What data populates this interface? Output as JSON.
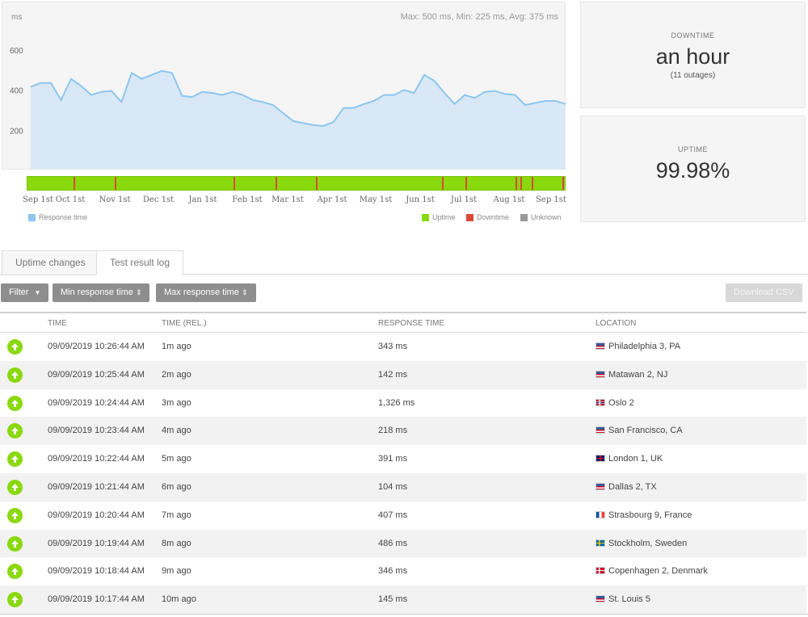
{
  "chart": {
    "y_unit": "ms",
    "stats": "Max: 500 ms, Min: 225 ms, Avg: 375 ms",
    "colors": {
      "fill": "#d9e8f6",
      "line": "#8cc6ee",
      "uptime": "#8ad80e",
      "downtime": "#d84a38",
      "unknown": "#999999"
    }
  },
  "chart_data": {
    "type": "area",
    "ylabel": "ms",
    "ylim": [
      0,
      700
    ],
    "yticks": [
      200,
      400,
      600
    ],
    "x_tick_labels": [
      "Sep 1st",
      "Oct 1st",
      "Nov 1st",
      "Dec 1st",
      "Jan 1st",
      "Feb 1st",
      "Mar 1st",
      "Apr 1st",
      "May 1st",
      "Jun 1st",
      "Jul 1st",
      "Aug 1st",
      "Sep 1st"
    ],
    "series": [
      {
        "name": "Response time",
        "values": [
          420,
          440,
          440,
          355,
          460,
          425,
          380,
          395,
          400,
          345,
          490,
          460,
          480,
          500,
          490,
          375,
          370,
          395,
          390,
          380,
          395,
          380,
          355,
          345,
          330,
          290,
          250,
          240,
          230,
          225,
          245,
          315,
          315,
          335,
          350,
          380,
          380,
          405,
          390,
          480,
          450,
          390,
          335,
          380,
          365,
          395,
          400,
          385,
          380,
          330,
          340,
          350,
          350,
          335
        ]
      }
    ],
    "status_bar": {
      "uptime_color": "#8ad80e",
      "downtime_color": "#d84a38",
      "outages_at": [
        0.085,
        0.163,
        0.384,
        0.462,
        0.537,
        0.771,
        0.815,
        0.909,
        0.917,
        0.938,
        0.996
      ]
    },
    "legend": [
      "Response time",
      "Uptime",
      "Downtime",
      "Unknown"
    ]
  },
  "legend": {
    "response_time": "Response time",
    "uptime": "Uptime",
    "downtime": "Downtime",
    "unknown": "Unknown"
  },
  "downtime": {
    "label": "DOWNTIME",
    "value": "an hour",
    "sub": "(11 outages)"
  },
  "uptime": {
    "label": "UPTIME",
    "value": "99.98%"
  },
  "tabs": [
    {
      "label": "Uptime changes"
    },
    {
      "label": "Test result log"
    }
  ],
  "toolbar": {
    "filter": "Filter",
    "min_response": "Min response time",
    "max_response": "Max response time",
    "download": "Download CSV"
  },
  "table": {
    "headers": [
      "TIME",
      "TIME (REL.)",
      "RESPONSE TIME",
      "LOCATION"
    ],
    "rows": [
      {
        "time": "09/09/2019 10:26:44 AM",
        "rel": "1m ago",
        "response": "343 ms",
        "location": "Philadelphia 3, PA",
        "flag": "us"
      },
      {
        "time": "09/09/2019 10:25:44 AM",
        "rel": "2m ago",
        "response": "142 ms",
        "location": "Matawan 2, NJ",
        "flag": "us"
      },
      {
        "time": "09/09/2019 10:24:44 AM",
        "rel": "3m ago",
        "response": "1,326 ms",
        "location": "Oslo 2",
        "flag": "no"
      },
      {
        "time": "09/09/2019 10:23:44 AM",
        "rel": "4m ago",
        "response": "218 ms",
        "location": "San Francisco, CA",
        "flag": "us"
      },
      {
        "time": "09/09/2019 10:22:44 AM",
        "rel": "5m ago",
        "response": "391 ms",
        "location": "London 1, UK",
        "flag": "gb"
      },
      {
        "time": "09/09/2019 10:21:44 AM",
        "rel": "6m ago",
        "response": "104 ms",
        "location": "Dallas 2, TX",
        "flag": "us"
      },
      {
        "time": "09/09/2019 10:20:44 AM",
        "rel": "7m ago",
        "response": "407 ms",
        "location": "Strasbourg 9, France",
        "flag": "fr"
      },
      {
        "time": "09/09/2019 10:19:44 AM",
        "rel": "8m ago",
        "response": "486 ms",
        "location": "Stockholm, Sweden",
        "flag": "se"
      },
      {
        "time": "09/09/2019 10:18:44 AM",
        "rel": "9m ago",
        "response": "346 ms",
        "location": "Copenhagen 2, Denmark",
        "flag": "dk"
      },
      {
        "time": "09/09/2019 10:17:44 AM",
        "rel": "10m ago",
        "response": "145 ms",
        "location": "St. Louis 5",
        "flag": "us"
      }
    ]
  }
}
